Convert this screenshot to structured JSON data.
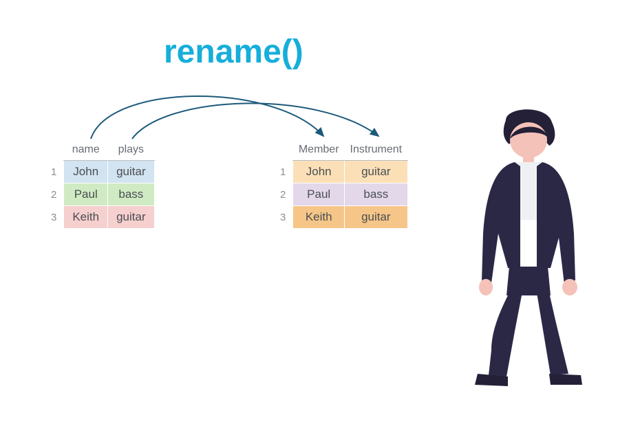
{
  "title": "rename()",
  "left_table": {
    "headers": [
      "name",
      "plays"
    ],
    "rows": [
      {
        "n": "1",
        "c1": "John",
        "c2": "guitar"
      },
      {
        "n": "2",
        "c1": "Paul",
        "c2": "bass"
      },
      {
        "n": "3",
        "c1": "Keith",
        "c2": "guitar"
      }
    ]
  },
  "right_table": {
    "headers": [
      "Member",
      "Instrument"
    ],
    "rows": [
      {
        "n": "1",
        "c1": "John",
        "c2": "guitar"
      },
      {
        "n": "2",
        "c1": "Paul",
        "c2": "bass"
      },
      {
        "n": "3",
        "c1": "Keith",
        "c2": "guitar"
      }
    ]
  },
  "arrows": {
    "from": [
      "name",
      "plays"
    ],
    "to": [
      "Member",
      "Instrument"
    ]
  },
  "illustration": "person-standing"
}
